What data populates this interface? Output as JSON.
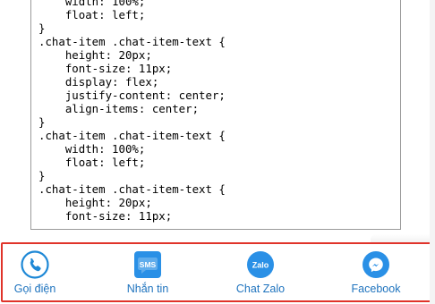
{
  "code_block": {
    "lines": [
      "    width: 100%;",
      "    float: left;",
      "}",
      ".chat-item .chat-item-text {",
      "    height: 20px;",
      "    font-size: 11px;",
      "    display: flex;",
      "    justify-content: center;",
      "    align-items: center;",
      "}",
      ".chat-item .chat-item-text {",
      "    width: 100%;",
      "    float: left;",
      "}",
      ".chat-item .chat-item-text {",
      "    height: 20px;",
      "    font-size: 11px;"
    ]
  },
  "contact_bar": {
    "accent_color": "#1e73be",
    "border_color": "#e0332a",
    "items": [
      {
        "label": "Gọi điện",
        "icon": "phone-icon"
      },
      {
        "label": "Nhắn tin",
        "icon": "sms-icon",
        "icon_text": "SMS"
      },
      {
        "label": "Chat Zalo",
        "icon": "zalo-icon",
        "icon_text": "Zalo"
      },
      {
        "label": "Facebook",
        "icon": "messenger-icon"
      }
    ]
  }
}
